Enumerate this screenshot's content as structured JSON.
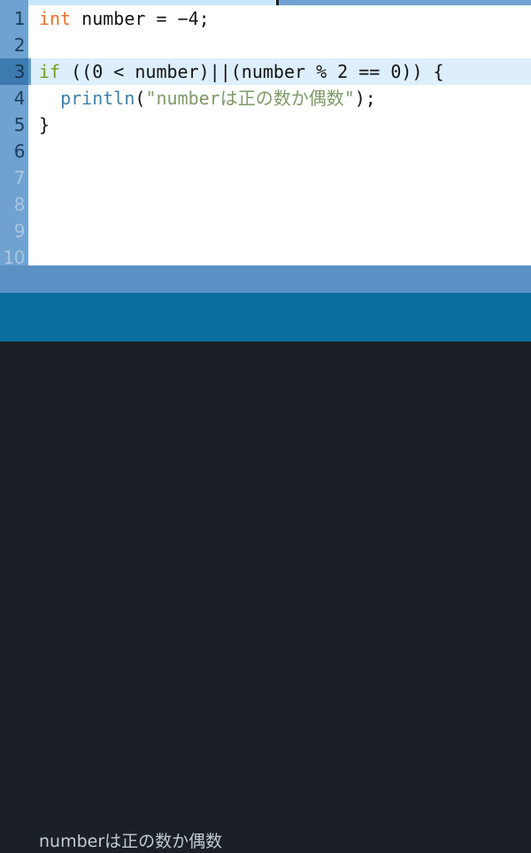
{
  "editor": {
    "active_line": 3,
    "colors": {
      "gutter_bg": "#6fa2d0",
      "gutter_active_bg": "#3d7ab0",
      "gutter_text": "#1d3f60",
      "gutter_text_dim": "#a9c6e0",
      "line_highlight_bg": "#ddeefc",
      "editor_bg": "#ffffff",
      "keyword_type": "#e8712a",
      "keyword_control": "#7d9b28",
      "function_name": "#3f7fa8",
      "string_literal": "#7e9a68",
      "plain_text": "#141414"
    },
    "lines": [
      {
        "number": "1",
        "dim": false,
        "active": false,
        "tokens": [
          {
            "text": "int",
            "type": "kw-type"
          },
          {
            "text": " number = −4;",
            "type": "plain"
          }
        ]
      },
      {
        "number": "2",
        "dim": false,
        "active": false,
        "tokens": []
      },
      {
        "number": "3",
        "dim": false,
        "active": true,
        "tokens": [
          {
            "text": "if",
            "type": "kw-ctrl"
          },
          {
            "text": " ((0 < number)||(number % 2 == 0)) {",
            "type": "plain"
          }
        ]
      },
      {
        "number": "4",
        "dim": false,
        "active": false,
        "tokens": [
          {
            "text": "  ",
            "type": "plain"
          },
          {
            "text": "println",
            "type": "fn"
          },
          {
            "text": "(",
            "type": "plain"
          },
          {
            "text": "\"numberは正の数か偶数\"",
            "type": "str"
          },
          {
            "text": ");",
            "type": "plain"
          }
        ]
      },
      {
        "number": "5",
        "dim": false,
        "active": false,
        "tokens": [
          {
            "text": "}",
            "type": "plain"
          }
        ]
      },
      {
        "number": "6",
        "dim": false,
        "active": false,
        "tokens": []
      },
      {
        "number": "7",
        "dim": true,
        "active": false,
        "tokens": []
      },
      {
        "number": "8",
        "dim": true,
        "active": false,
        "tokens": []
      },
      {
        "number": "9",
        "dim": true,
        "active": false,
        "tokens": []
      },
      {
        "number": "10",
        "dim": true,
        "active": false,
        "tokens": []
      }
    ]
  },
  "bands": {
    "upper_color": "#5b90c4",
    "lower_color": "#0b6e9f"
  },
  "console": {
    "background": "#1b1f26",
    "text_color": "#c3ccd6",
    "output": "numberは正の数か偶数"
  }
}
